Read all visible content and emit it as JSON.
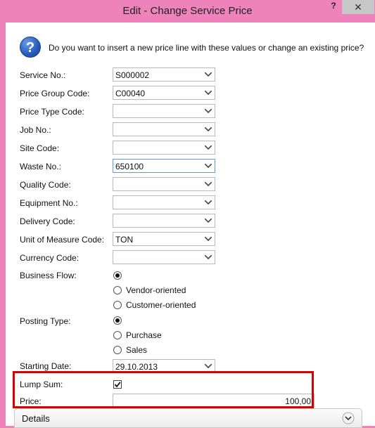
{
  "window": {
    "title": "Edit - Change Service Price",
    "help_label": "?",
    "close_label": "✕"
  },
  "dialog": {
    "icon": "question-icon",
    "icon_glyph": "?",
    "question": "Do you want to insert a new price line with these values or change an existing price?",
    "fields": [
      {
        "label": "Service No.:",
        "value": "S000002"
      },
      {
        "label": "Price Group Code:",
        "value": "C00040"
      },
      {
        "label": "Price Type Code:",
        "value": ""
      },
      {
        "label": "Job No.:",
        "value": ""
      },
      {
        "label": "Site Code:",
        "value": ""
      },
      {
        "label": "Waste No.:",
        "value": "650100"
      },
      {
        "label": "Quality Code:",
        "value": ""
      },
      {
        "label": "Equipment No.:",
        "value": ""
      },
      {
        "label": "Delivery Code:",
        "value": ""
      },
      {
        "label": "Unit of Measure Code:",
        "value": "TON"
      },
      {
        "label": "Currency Code:",
        "value": ""
      }
    ],
    "business_flow": {
      "label": "Business Flow:",
      "options": [
        "Vendor-oriented",
        "Customer-oriented"
      ]
    },
    "posting_type": {
      "label": "Posting Type:",
      "options": [
        "Purchase",
        "Sales"
      ]
    },
    "starting_date": {
      "label": "Starting Date:",
      "value": "29.10.2013"
    },
    "lump_sum": {
      "label": "Lump Sum:",
      "checked": true
    },
    "price": {
      "label": "Price:",
      "value": "100,00"
    },
    "details": {
      "label": "Details"
    }
  },
  "colors": {
    "titlebar": "#ee82ba",
    "highlight": "#d90000",
    "focus": "#5aa0d8"
  }
}
